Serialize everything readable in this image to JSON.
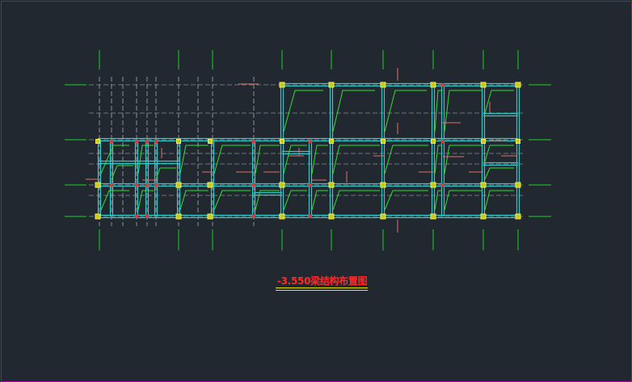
{
  "drawing": {
    "title": "-3.550梁结构布置图"
  },
  "colors": {
    "background": "#212830",
    "border": "#b000b0",
    "axis": "#20d020",
    "beam": "#30c8c8",
    "beam_inner": "#1a8a96",
    "column_fill": "#c8c820",
    "column_edge": "#f0f050",
    "leader": "#30e030",
    "dimension": "#e07070",
    "grid_grey": "#8a8f94",
    "title": "#ff2a2a",
    "underline": "#e8e800"
  }
}
